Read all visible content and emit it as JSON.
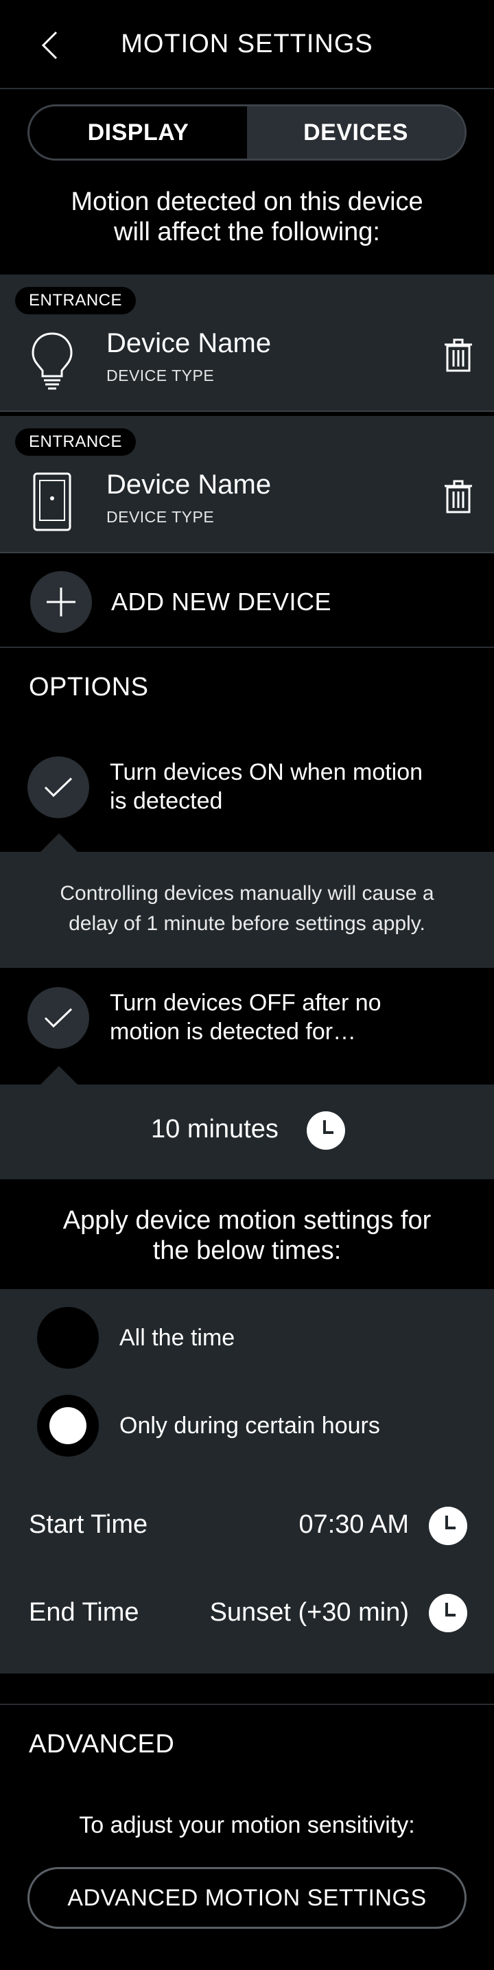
{
  "header": {
    "title": "MOTION SETTINGS"
  },
  "tabs": [
    {
      "label": "DISPLAY"
    },
    {
      "label": "DEVICES"
    }
  ],
  "intro": {
    "line1": "Motion detected on this device",
    "line2": "will affect the following:"
  },
  "devices": [
    {
      "tag": "ENTRANCE",
      "name": "Device Name",
      "type": "DEVICE TYPE",
      "icon": "lightbulb-icon"
    },
    {
      "tag": "ENTRANCE",
      "name": "Device Name",
      "type": "DEVICE TYPE",
      "icon": "switch-icon"
    }
  ],
  "add_device": {
    "label": "ADD NEW DEVICE"
  },
  "options": {
    "title": "OPTIONS",
    "on_motion": {
      "line1": "Turn devices ON when motion",
      "line2": "is detected",
      "checked": true
    },
    "on_note": {
      "line1": "Controlling devices manually will cause a",
      "line2": "delay of 1 minute before settings apply."
    },
    "off_motion": {
      "line1": "Turn devices OFF after no",
      "line2": "motion is detected for…",
      "checked": true
    },
    "duration": "10 minutes"
  },
  "apply": {
    "line1": "Apply device motion settings for",
    "line2": "the below times:"
  },
  "schedule": {
    "all_time": "All the time",
    "certain_hours": "Only during certain hours",
    "selected": "certain_hours",
    "start_label": "Start Time",
    "start_value": "07:30 AM",
    "end_label": "End Time",
    "end_value": "Sunset (+30 min)"
  },
  "advanced": {
    "title": "ADVANCED",
    "note": "To adjust your motion sensitivity:",
    "button": "ADVANCED MOTION SETTINGS"
  }
}
